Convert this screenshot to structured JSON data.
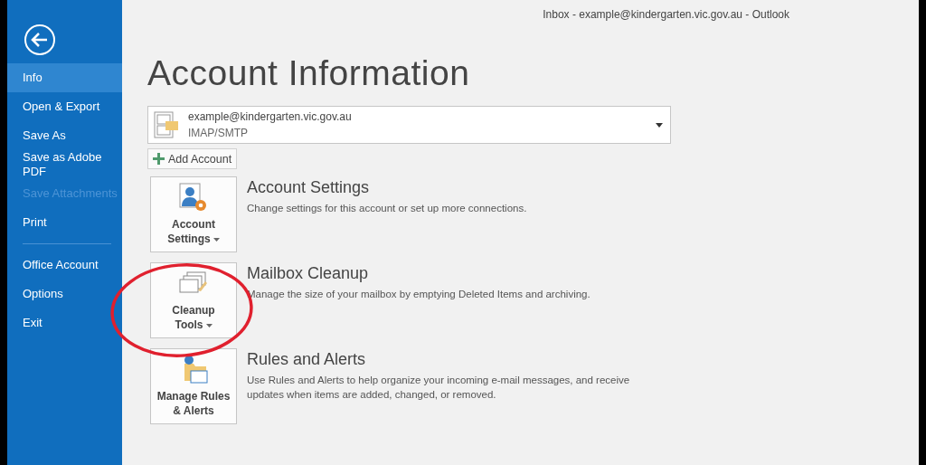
{
  "window": {
    "title": "Inbox - example@kindergarten.vic.gov.au - Outlook"
  },
  "sidebar": {
    "items": [
      {
        "kind": "item",
        "label": "Info",
        "selected": true,
        "disabled": false
      },
      {
        "kind": "item",
        "label": "Open & Export",
        "selected": false,
        "disabled": false
      },
      {
        "kind": "item",
        "label": "Save As",
        "selected": false,
        "disabled": false
      },
      {
        "kind": "item",
        "label": "Save as Adobe PDF",
        "selected": false,
        "disabled": false
      },
      {
        "kind": "item",
        "label": "Save Attachments",
        "selected": false,
        "disabled": true
      },
      {
        "kind": "item",
        "label": "Print",
        "selected": false,
        "disabled": false
      },
      {
        "kind": "separator"
      },
      {
        "kind": "item",
        "label": "Office Account",
        "selected": false,
        "disabled": false
      },
      {
        "kind": "item",
        "label": "Options",
        "selected": false,
        "disabled": false
      },
      {
        "kind": "item",
        "label": "Exit",
        "selected": false,
        "disabled": false
      }
    ]
  },
  "page_title": "Account Information",
  "account": {
    "email": "example@kindergarten.vic.gov.au",
    "type": "IMAP/SMTP"
  },
  "add_account_button": "Add Account",
  "sections": [
    {
      "kind": "settings",
      "button": "Account\nSettings",
      "dropdown": true,
      "heading": "Account Settings",
      "description": "Change settings for this account or set up more connections.",
      "highlighted": false
    },
    {
      "kind": "cleanup",
      "button": "Cleanup\nTools",
      "dropdown": true,
      "heading": "Mailbox Cleanup",
      "description": "Manage the size of your mailbox by emptying Deleted Items and archiving.",
      "highlighted": true
    },
    {
      "kind": "rules",
      "button": "Manage Rules\n& Alerts",
      "dropdown": false,
      "heading": "Rules and Alerts",
      "description": "Use Rules and Alerts to help organize your incoming e-mail messages, and receive updates when items are added, changed, or removed.",
      "highlighted": false
    }
  ]
}
